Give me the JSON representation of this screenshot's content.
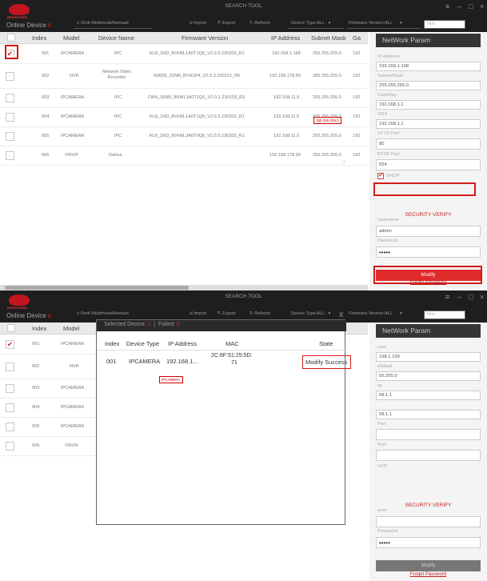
{
  "app": {
    "title": "SEARCH TOOL",
    "logo_text": "RENGUFEED",
    "online_label": "Online Device",
    "online_count": "6",
    "toolbar": {
      "omit_label": "Omit MultimodeNetmast",
      "import_label": "Import",
      "export_label": "Export",
      "refresh_label": "Refresh",
      "device_type": "Device Type:ALL",
      "firmware_version": "Firmware Version:ALL",
      "search_placeholder": "filter"
    },
    "window_controls": [
      "≡",
      "–",
      "□",
      "×"
    ]
  },
  "table": {
    "headers": [
      "Index",
      "Model",
      "Device Name",
      "Firmware Version",
      "IP Address",
      "Subnet Mask",
      "Ga"
    ],
    "rows": [
      {
        "checked": "✔",
        "index": "001",
        "model": "IPCAMERA",
        "name": "IPC",
        "firmware": "KL8_1ND_BVH0L1A0T1Q0_V2.0.5.230203_R1",
        "ip": "192.168.1.168",
        "mask": "255.255.255.0",
        "gw": "192"
      },
      {
        "checked": "",
        "index": "002",
        "model": "NVR",
        "name": "Network Video Recorder",
        "firmware": "N3009_32NR_BVH1P4_V2.0.3.230221_R5",
        "ip": "192.168.178.59",
        "mask": "255.255.255.0",
        "gw": "192"
      },
      {
        "checked": "",
        "index": "003",
        "model": "IPCAMERA",
        "name": "IPC",
        "firmware": "FW4_16NR_BVML1A0T1Q0_V2.0.1.230103_R3",
        "ip": "192.168.11.9",
        "mask": "255.255.255.0",
        "gw": "192"
      },
      {
        "checked": "",
        "index": "004",
        "model": "IPCAMERA",
        "name": "IPC",
        "firmware": "KL8_1ND_BVH0L1A0T1Q0_V2.0.5.230203_R1",
        "ip": "192.168.11.6",
        "mask": "255.255.255.0",
        "gw": "192"
      },
      {
        "checked": "",
        "index": "005",
        "model": "IPCAMERA",
        "name": "IPC",
        "firmware": "KL8_1ND_BVH0L3A0T0Q0_V2.0.5.230203_R1",
        "ip": "192.168.11.5",
        "mask": "255.255.255.0",
        "gw": "192"
      },
      {
        "checked": "",
        "index": "006",
        "model": "ONVIF",
        "name": "Dahua",
        "firmware": "",
        "ip": "192.168.178.99",
        "mask": "255.255.255.0",
        "gw": "192"
      }
    ],
    "tooltip": "255.255.255.0"
  },
  "sidebar": {
    "header": "NetWork Param",
    "ip_label": "IP Address",
    "ip_value": "192.168.1.168",
    "mask_label": "SubnetMask",
    "mask_value": "255.255.255.0",
    "gw_label": "GateWay",
    "gw_value": "192.168.1.1",
    "dns_label": "DNS",
    "dns_value": "192.168.1.1",
    "http_label": "HTTP Port",
    "http_value": "80",
    "rtsp_label": "RTSP Port",
    "rtsp_value": "554",
    "dhcp_label": "DHCP",
    "dhcp_checked": "✔",
    "security_label": "SECURITY VERIFY",
    "user_label": "Username",
    "user_value": "admin",
    "pass_label": "Password",
    "pass_value": "•••••",
    "modify_label": "Modify",
    "forgot_label": "Forget Password"
  },
  "dialog": {
    "selected_label": "Selected Device:",
    "selected_count": "1",
    "sep": "|",
    "failed_label": "Failed:",
    "failed_count": "0",
    "close": "X",
    "headers": [
      "Index",
      "Device Type",
      "IP Address",
      "MAC",
      "State"
    ],
    "row": {
      "index": "001",
      "type": "IPCAMERA",
      "ip": "192.168.1...",
      "mac1": "2C:6F:51:25:5D:",
      "mac2": "71",
      "state": "Modify Success"
    },
    "tooltip": "IPCAMERA"
  },
  "w2_sidebar": {
    "f1": "168.1.168",
    "l2": "etMask",
    "f2": "55.255.0",
    "l3": "ay",
    "f3": "68.1.1",
    "f4": "68.1.1",
    "l5": "Port",
    "l6": "Port",
    "l7": "HCP",
    "l0": "ress",
    "l1": "ame"
  }
}
